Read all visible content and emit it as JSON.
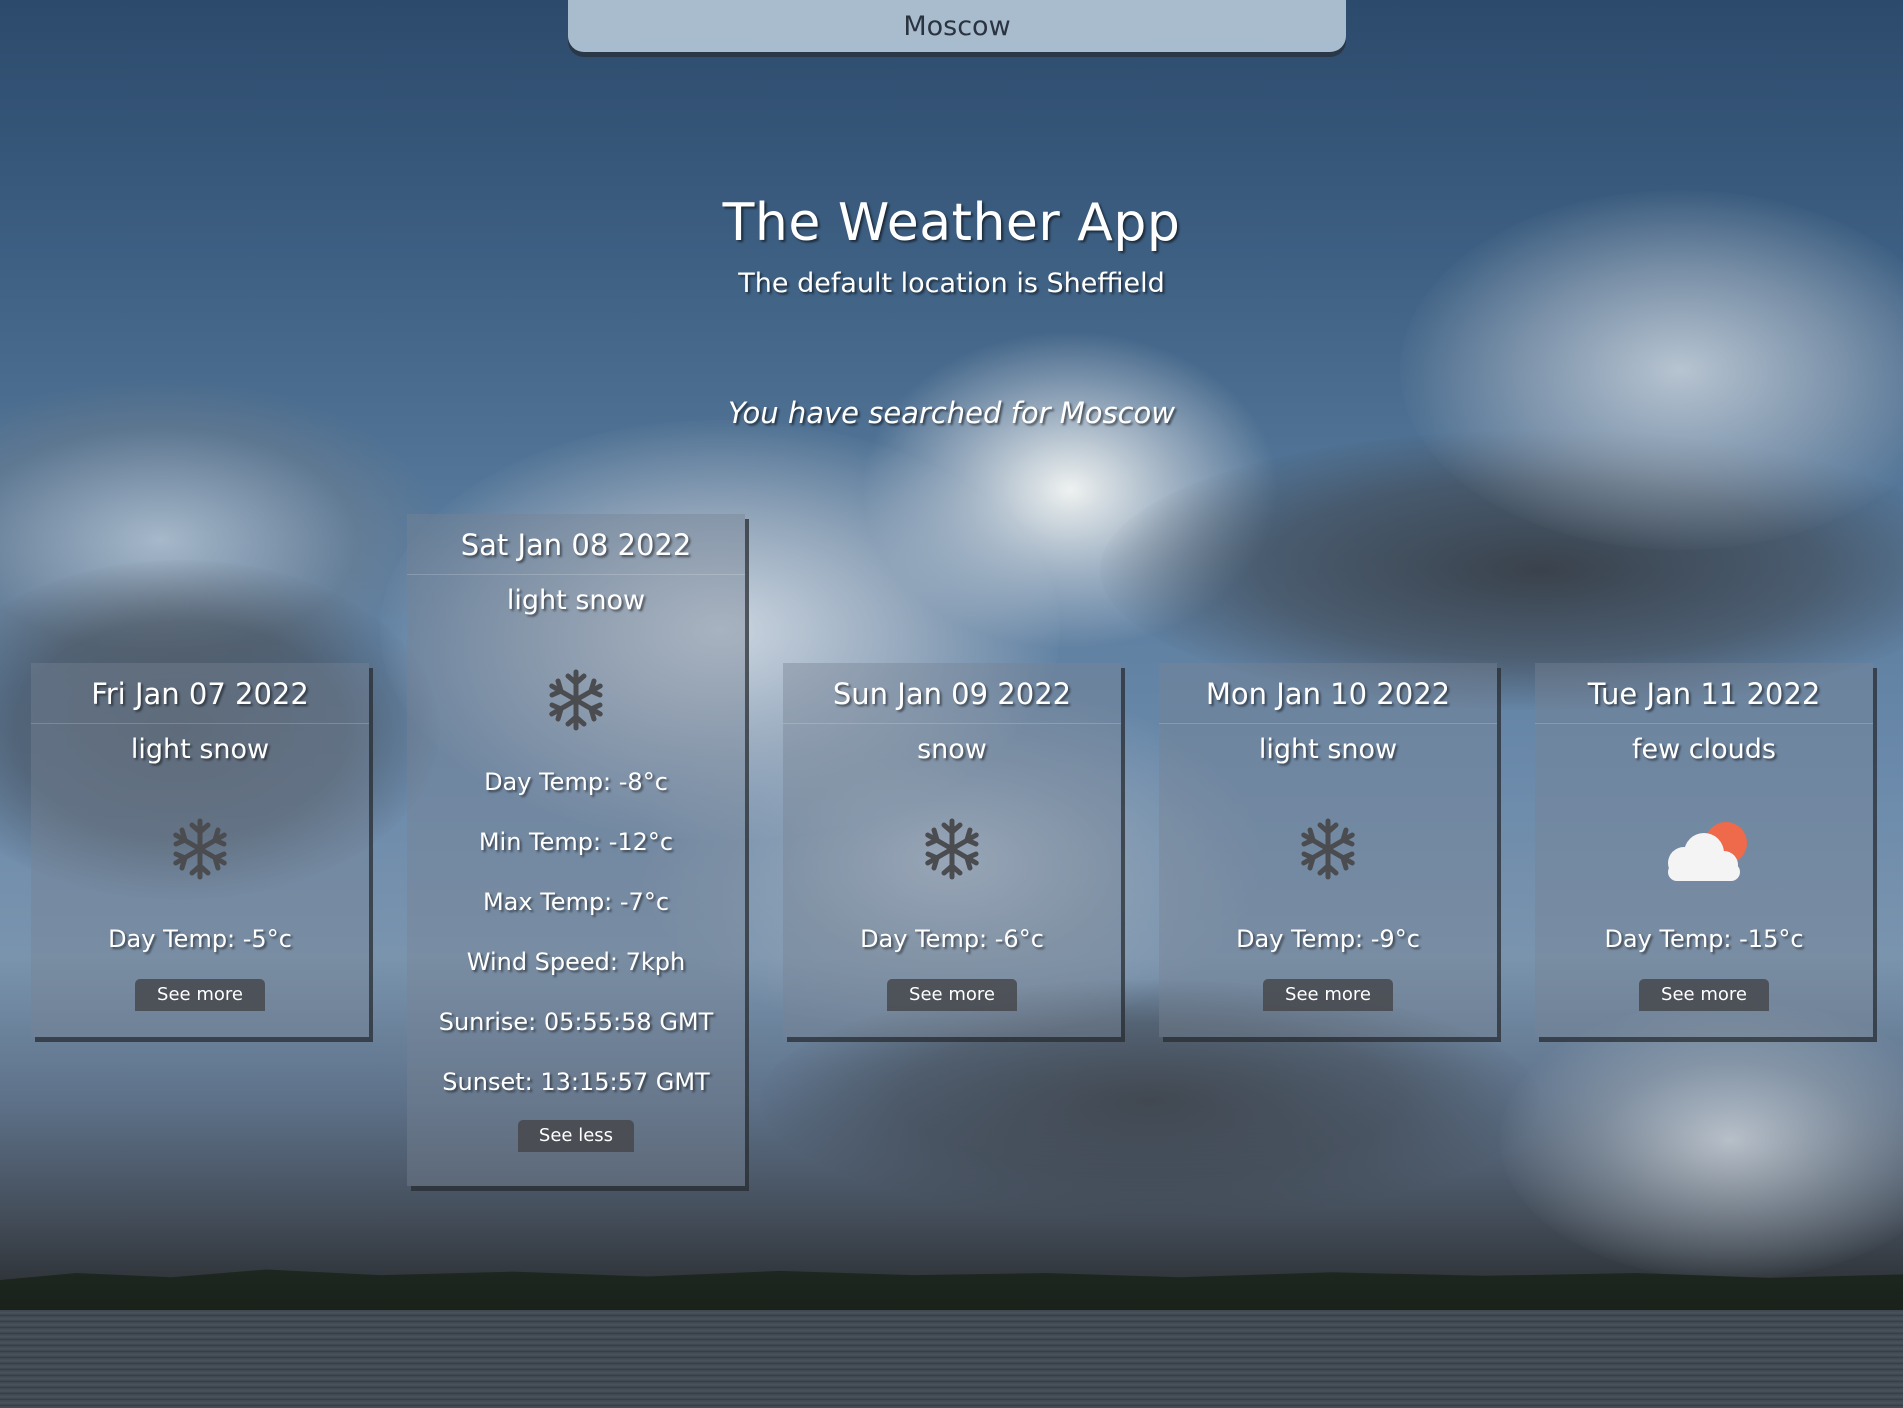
{
  "search": {
    "value": "Moscow"
  },
  "header": {
    "title": "The Weather App",
    "subtitle": "The default location is Sheffield",
    "searched": "You have searched for Moscow"
  },
  "cards": [
    {
      "date": "Fri Jan 07 2022",
      "description": "light snow",
      "icon": "snowflake-icon",
      "day_temp": "Day Temp: -5°c",
      "button": "See more"
    },
    {
      "date": "Sat Jan 08 2022",
      "description": "light snow",
      "icon": "snowflake-icon",
      "day_temp": "Day Temp: -8°c",
      "min_temp": "Min Temp: -12°c",
      "max_temp": "Max Temp: -7°c",
      "wind_speed": "Wind Speed: 7kph",
      "sunrise": "Sunrise: 05:55:58 GMT",
      "sunset": "Sunset: 13:15:57 GMT",
      "button": "See less"
    },
    {
      "date": "Sun Jan 09 2022",
      "description": "snow",
      "icon": "snowflake-icon",
      "day_temp": "Day Temp: -6°c",
      "button": "See more"
    },
    {
      "date": "Mon Jan 10 2022",
      "description": "light snow",
      "icon": "snowflake-icon",
      "day_temp": "Day Temp: -9°c",
      "button": "See more"
    },
    {
      "date": "Tue Jan 11 2022",
      "description": "few clouds",
      "icon": "sun-behind-cloud-icon",
      "day_temp": "Day Temp: -15°c",
      "button": "See more"
    }
  ],
  "colors": {
    "snowflake": "#4a4c50",
    "sun": "#ee6a4a",
    "cloud": "#f4f4f4"
  }
}
